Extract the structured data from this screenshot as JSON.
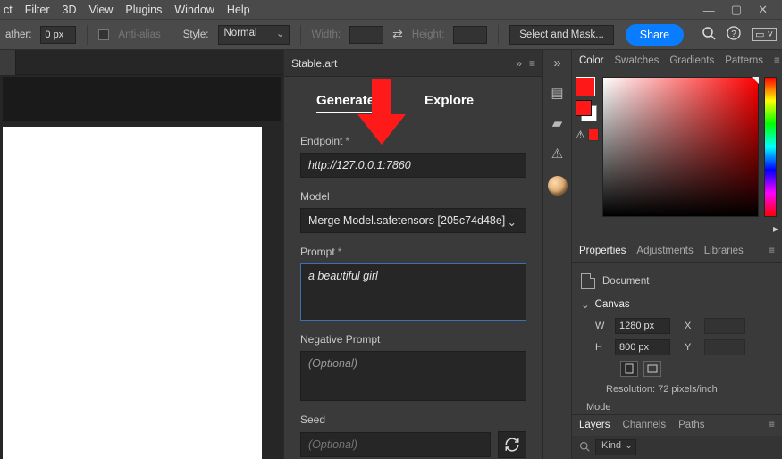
{
  "menubar": {
    "items": [
      "ct",
      "Filter",
      "3D",
      "View",
      "Plugins",
      "Window",
      "Help"
    ]
  },
  "optbar": {
    "feather_label": "ather:",
    "feather_value": "0 px",
    "antialias_label": "Anti-alias",
    "style_label": "Style:",
    "style_value": "Normal",
    "width_label": "Width:",
    "height_label": "Height:",
    "select_mask": "Select and Mask...",
    "share": "Share"
  },
  "plugin": {
    "title": "Stable.art",
    "tabs": {
      "generate": "Generate",
      "explore": "Explore"
    },
    "endpoint_label": "Endpoint",
    "endpoint_value": "http://127.0.0.1:7860",
    "model_label": "Model",
    "model_value": "Merge Model.safetensors [205c74d48e]",
    "prompt_label": "Prompt",
    "prompt_value": "a beautiful girl",
    "negprompt_label": "Negative Prompt",
    "negprompt_placeholder": "(Optional)",
    "seed_label": "Seed",
    "seed_placeholder": "(Optional)"
  },
  "color_panel": {
    "tabs": [
      "Color",
      "Swatches",
      "Gradients",
      "Patterns"
    ]
  },
  "properties": {
    "tabs": [
      "Properties",
      "Adjustments",
      "Libraries"
    ],
    "document_label": "Document",
    "canvas_label": "Canvas",
    "w_label": "W",
    "w_value": "1280 px",
    "h_label": "H",
    "h_value": "800 px",
    "x_label": "X",
    "y_label": "Y",
    "resolution": "Resolution:  72 pixels/inch",
    "mode_label": "Mode"
  },
  "layers_panel": {
    "tabs": [
      "Layers",
      "Channels",
      "Paths"
    ],
    "filter_value": "Kind"
  }
}
